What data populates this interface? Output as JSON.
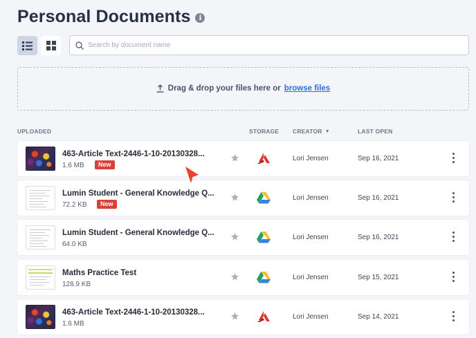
{
  "page": {
    "title": "Personal Documents",
    "info_icon": "i"
  },
  "toolbar": {
    "list_view_icon": "list-view-icon",
    "grid_view_icon": "grid-view-icon",
    "search_placeholder": "Search by document name",
    "search_value": ""
  },
  "dropzone": {
    "text": "Drag & drop your files here or",
    "link": "browse files",
    "icon": "upload-icon"
  },
  "columns": {
    "uploaded": "UPLOADED",
    "storage": "STORAGE",
    "creator": "CREATOR",
    "last_open": "LAST OPEN"
  },
  "documents": [
    {
      "name": "463-Article Text-2446-1-10-20130328...",
      "size": "1.6 MB",
      "badge": "New",
      "thumbnail": "art",
      "storage": "lumin",
      "creator": "Lori Jensen",
      "last_open": "Sep 16, 2021"
    },
    {
      "name": "Lumin Student - General Knowledge Q...",
      "size": "72.2 KB",
      "badge": "New",
      "thumbnail": "paper",
      "storage": "google-drive",
      "creator": "Lori Jensen",
      "last_open": "Sep 16, 2021"
    },
    {
      "name": "Lumin Student - General Knowledge Q...",
      "size": "64.0 KB",
      "badge": "",
      "thumbnail": "paper",
      "storage": "google-drive",
      "creator": "Lori Jensen",
      "last_open": "Sep 16, 2021"
    },
    {
      "name": "Maths Practice Test",
      "size": "128.9 KB",
      "badge": "",
      "thumbnail": "maths",
      "storage": "google-drive",
      "creator": "Lori Jensen",
      "last_open": "Sep 15, 2021"
    },
    {
      "name": "463-Article Text-2446-1-10-20130328...",
      "size": "1.6 MB",
      "badge": "",
      "thumbnail": "art",
      "storage": "lumin",
      "creator": "Lori Jensen",
      "last_open": "Sep 14, 2021"
    }
  ],
  "colors": {
    "accent": "#2f6fd0",
    "new_badge": "#d9403a",
    "lumin_red": "#e0352b",
    "cursor": "#e8452c"
  }
}
